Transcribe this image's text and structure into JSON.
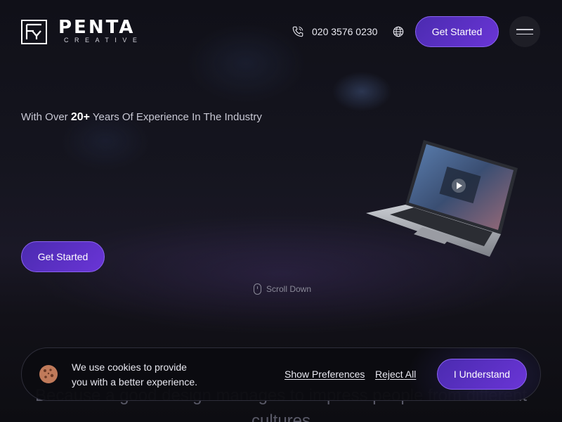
{
  "brand": {
    "name": "PENTA",
    "subtitle": "CREATIVE"
  },
  "header": {
    "phone": "020 3576 0230",
    "cta_label": "Get Started"
  },
  "hero": {
    "tagline_before": "With Over ",
    "tagline_highlight": "20+",
    "tagline_after": " Years Of Experience In The Industry",
    "cta_label": "Get Started",
    "scroll_label": "Scroll Down"
  },
  "background_text": {
    "line1": "Because a good design manages to impress people from different",
    "line2": "cultures"
  },
  "cookie_banner": {
    "line1": "We use cookies to provide",
    "line2": "you with a better experience.",
    "show_preferences": "Show Preferences",
    "reject_all": "Reject All",
    "accept": "I Understand"
  },
  "icons": {
    "phone": "phone-icon",
    "globe": "globe-icon",
    "menu": "hamburger-menu-icon",
    "cookie": "cookie-icon",
    "mouse": "mouse-icon"
  },
  "colors": {
    "accent": "#5a30c8",
    "background": "#121118"
  }
}
